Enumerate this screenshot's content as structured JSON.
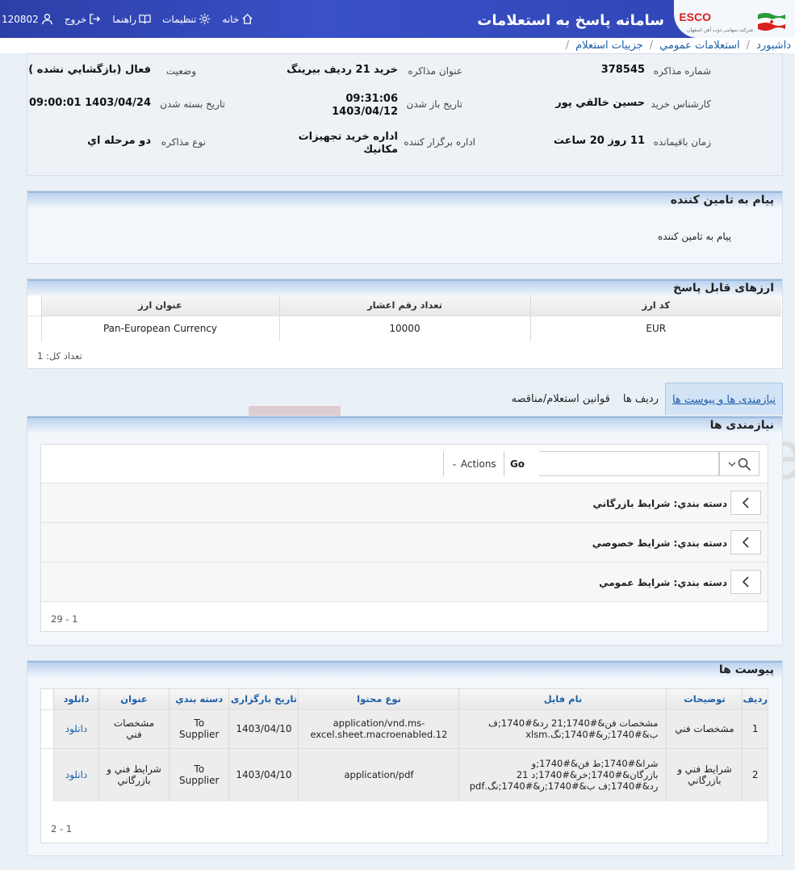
{
  "header": {
    "app_title": "سامانه پاسخ به استعلامات",
    "logo_text": "ESCO",
    "logo_subtitle": "شرکت سهامی ذوب آهن اصفهان",
    "user_id": "120802",
    "nav": {
      "home": "خانه",
      "settings": "تنظیمات",
      "help": "راهنما",
      "logout": "خروج"
    }
  },
  "breadcrumb": [
    "ه داشبورد",
    "استعلامات عمومي",
    "جزييات استعلام"
  ],
  "info": {
    "number_label": "شماره مذاکره",
    "number": "378545",
    "title_label": "عنوان مذاکره",
    "title": "خرید 21 ردیف بیرینگ",
    "status_label": "وضعیت",
    "status": "فعال (بازگشايي نشده )",
    "expert_label": "کارشناس خرید",
    "expert": "حسين خالقي پور",
    "open_label": "تاریخ باز شدن",
    "open_time": "09:31:06",
    "open_date": "1403/04/12",
    "close_label": "تاریخ بسته شدن",
    "close": "1403/04/24 09:00:01",
    "remain_label": "زمان باقیمانده",
    "remain": "11 روز 20 ساعت",
    "dept_label": "اداره برگزار کننده",
    "dept_1": "اداره خريد تجهيزات",
    "dept_2": "مكانيك",
    "type_label": "نوع مذاکره",
    "type": "دو مرحله اي"
  },
  "message": {
    "title": "پیام به تامین کننده",
    "body": "پیام به تامین کننده"
  },
  "currency": {
    "title": "ارزهای قابل پاسخ",
    "headers": [
      "کد ارز",
      "تعداد رقم اعشار",
      "عنوان ارز"
    ],
    "rows": [
      [
        "EUR",
        "10000",
        "Pan-European Currency"
      ]
    ],
    "count": "تعداد کل: 1"
  },
  "tabs": [
    "نیازمندی ها و پیوست ها",
    "رديف ها",
    "قوانين استعلام/مناقصه"
  ],
  "requirements": {
    "title": "نیازمندی ها",
    "go_label": "Go",
    "actions_label": "Actions",
    "category_label": "دسته بندي:",
    "items": [
      "شرايط بازرگاني",
      "شرايط خصوصي",
      "شرايط عمومي"
    ],
    "pager": "1 - 29"
  },
  "attachments": {
    "title": "پیوست ها",
    "headers": [
      "رديف",
      "توضيحات",
      "نام فايل",
      "نوع محتوا",
      "تاریخ بارگزاری",
      "دسته بندي",
      "عنوان",
      "دانلود"
    ],
    "rows": [
      [
        "1",
        "مشخصات فني",
        "مشخصات فن&#1740;21 رد&#1740;ف ب&#1740;ر&#1740;نگ.xlsm",
        "application/vnd.ms-excel.sheet.macroenabled.12",
        "1403/04/10",
        "To Supplier",
        "مشخصات فني",
        "دانلود"
      ],
      [
        "2",
        "شرايط فني و بازرگاني",
        "شرا&#1740;ط فن&#1740;و بازرگان&#1740;خر&#1740;د 21 رد&#1740;ف ب&#1740;ر&#1740;نگ.pdf",
        "application/pdf",
        "1403/04/10",
        "To Supplier",
        "شرايط فني و بازرگاني",
        "دانلود"
      ]
    ],
    "pager": "1 - 2"
  },
  "watermark": "AriaTender.neT",
  "colors": {
    "header_bg": "#2f44b4",
    "link": "#1d5fa8",
    "panel_head": "#bcd2ee"
  }
}
